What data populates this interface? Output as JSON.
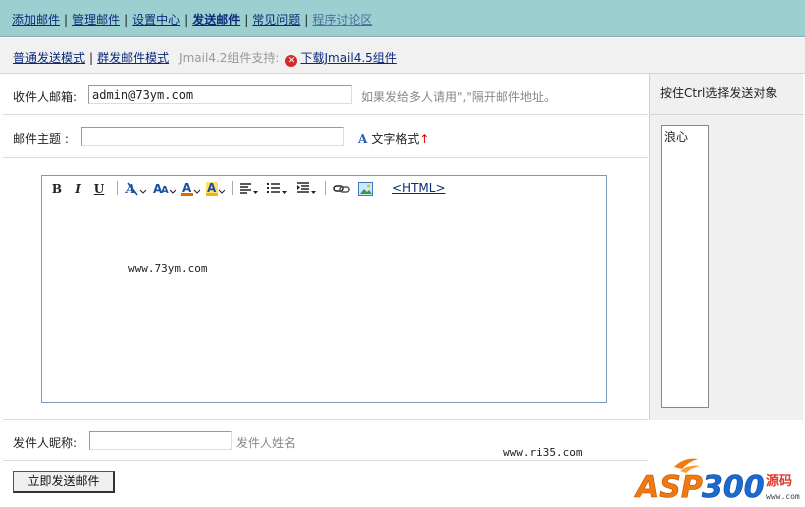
{
  "topnav": {
    "items": [
      "添加邮件",
      "管理邮件",
      "设置中心",
      "发送邮件",
      "常见问题",
      "程序讨论区"
    ],
    "separator": "|"
  },
  "subnav": {
    "normal_mode": "普通发送模式",
    "group_mode": "群发邮件模式",
    "support_text": "Jmail4.2组件支持:",
    "download_link": "下载Jmail4.5组件"
  },
  "form": {
    "recipient_label": "收件人邮箱:",
    "recipient_value": "admin@73ym.com",
    "recipient_hint": "如果发给多人请用\",\"隔开邮件地址。",
    "subject_label": "邮件主题 :",
    "subject_value": "",
    "text_format_label": "文字格式",
    "sender_label": "发件人昵称:",
    "sender_value": "",
    "sender_hint": "发件人姓名",
    "send_button": "立即发送邮件"
  },
  "editor": {
    "toolbar": {
      "bold": "B",
      "italic": "I",
      "underline": "U",
      "html_toggle": "<HTML>"
    },
    "content": "www.73ym.com"
  },
  "right_panel": {
    "title": "按住Ctrl选择发送对象",
    "options": [
      "浪心"
    ]
  },
  "watermarks": {
    "site_text": "www.ri35.com",
    "logo_text": "ASP300",
    "logo_cn": "源码",
    "logo_url": "www.com"
  },
  "colors": {
    "topnav_bg": "#9ccfcf",
    "link": "#0a2a7a",
    "logo_orange": "#f07a10",
    "logo_blue": "#1a6ad0"
  }
}
